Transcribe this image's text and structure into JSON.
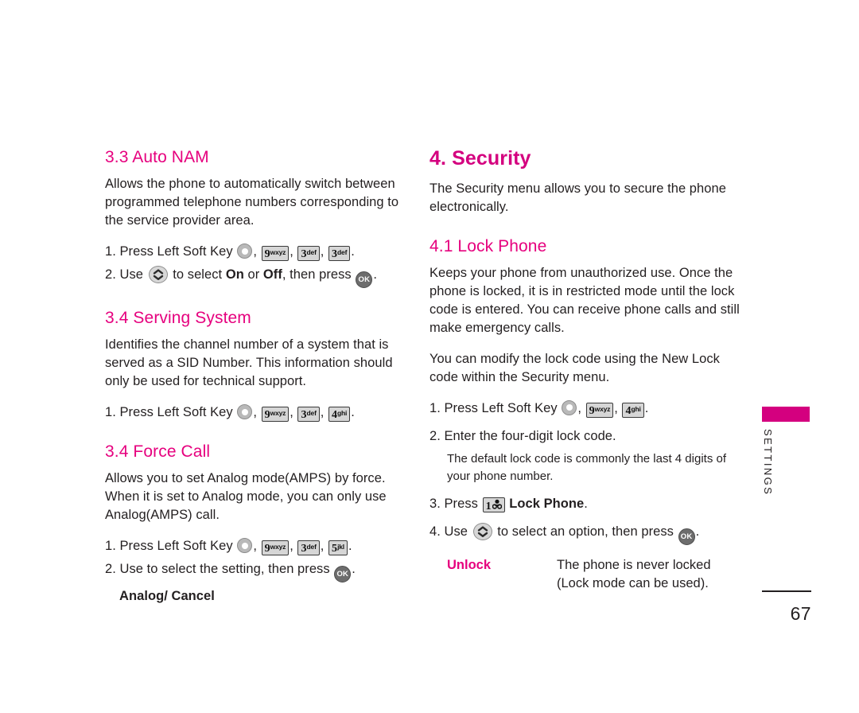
{
  "page": {
    "number": "67",
    "side_tab_label": "SETTINGS",
    "accent_color": "#e6007e",
    "tab_bar_color": "#d4007f"
  },
  "left_column": {
    "sections": [
      {
        "heading": "3.3 Auto NAM",
        "body": "Allows the phone to automatically switch between programmed telephone numbers corresponding to the service provider area.",
        "step1_prefix": "1. Press Left Soft Key",
        "step1_keys": [
          {
            "digit": "9",
            "letters": "wxyz"
          },
          {
            "digit": "3",
            "letters": "def"
          },
          {
            "digit": "3",
            "letters": "def"
          }
        ],
        "step2_prefix": "2. Use",
        "step2_mid": "to select",
        "step2_bold_a": "On",
        "step2_or": "or",
        "step2_bold_b": "Off",
        "step2_tail": ", then press"
      },
      {
        "heading": "3.4 Serving System",
        "body": "Identifies the channel number of a system that is served as a SID Number. This information should only be used for technical support.",
        "step1_prefix": "1. Press Left Soft Key",
        "step1_keys": [
          {
            "digit": "9",
            "letters": "wxyz"
          },
          {
            "digit": "3",
            "letters": "def"
          },
          {
            "digit": "4",
            "letters": "ghi"
          }
        ]
      },
      {
        "heading": "3.4 Force Call",
        "body": "Allows you to set Analog mode(AMPS) by force. When it is set to Analog mode, you can only use Analog(AMPS) call.",
        "step1_prefix": "1. Press Left Soft Key",
        "step1_keys": [
          {
            "digit": "9",
            "letters": "wxyz"
          },
          {
            "digit": "3",
            "letters": "def"
          },
          {
            "digit": "5",
            "letters": "jkl"
          }
        ],
        "step2_text": "2. Use  to select the setting, then press",
        "options_line": "Analog/ Cancel"
      }
    ]
  },
  "right_column": {
    "title": "4. Security",
    "intro": "The Security menu allows you to secure the phone electronically.",
    "subsection": {
      "heading": "4.1 Lock Phone",
      "para1": "Keeps your phone from unauthorized use. Once the phone is locked, it is in restricted mode until the lock code is entered. You can receive phone calls and still make emergency calls.",
      "para2": "You can modify the lock code using the New Lock code within the Security menu.",
      "step1_prefix": "1. Press Left Soft Key",
      "step1_keys": [
        {
          "digit": "9",
          "letters": "wxyz"
        },
        {
          "digit": "4",
          "letters": "ghi"
        }
      ],
      "step2": "2. Enter the four-digit lock code.",
      "step2_note": "The default lock code is commonly the last 4 digits of your phone number.",
      "step3_prefix": "3. Press",
      "step3_key": {
        "digit": "1",
        "letters": "voicemail"
      },
      "step3_bold": "Lock Phone",
      "step3_tail": ".",
      "step4_prefix": "4. Use",
      "step4_mid": "to select an option, then press",
      "step4_tail": ".",
      "options": [
        {
          "name": "Unlock",
          "desc_line1": "The phone is never locked",
          "desc_line2": "(Lock mode can be used)."
        }
      ]
    }
  },
  "icons": {
    "soft_key": "soft-key-icon",
    "nav_key": "navigation-key-icon",
    "ok_key": "OK",
    "voicemail_key": "voicemail-key-icon"
  }
}
